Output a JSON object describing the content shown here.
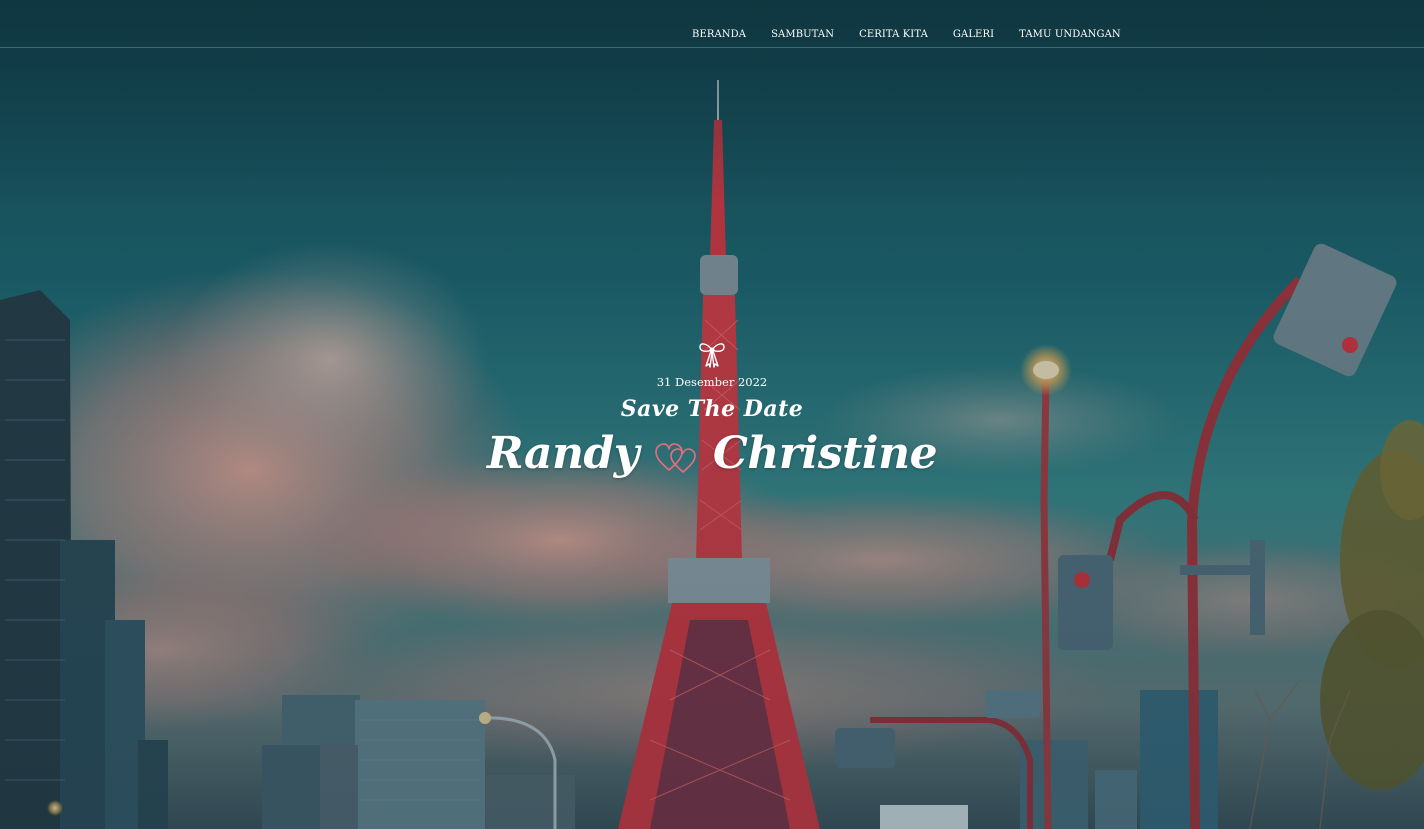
{
  "nav": {
    "items": [
      {
        "label": "BERANDA"
      },
      {
        "label": "SAMBUTAN"
      },
      {
        "label": "CERITA KITA"
      },
      {
        "label": "GALERI"
      },
      {
        "label": "TAMU UNDANGAN"
      }
    ]
  },
  "hero": {
    "date": "31 Desember 2022",
    "tagline": "Save The Date",
    "groom": "Randy",
    "bride": "Christine",
    "icons": {
      "top": "bow-icon",
      "between_names": "double-heart-icon"
    }
  },
  "colors": {
    "sky_top": "#1a4e5a",
    "sky_mid": "#2a7a82",
    "cloud_pink": "#e09a90",
    "tower_red": "#e33d45",
    "heart_pink": "#f06a7e",
    "text": "#ffffff"
  }
}
